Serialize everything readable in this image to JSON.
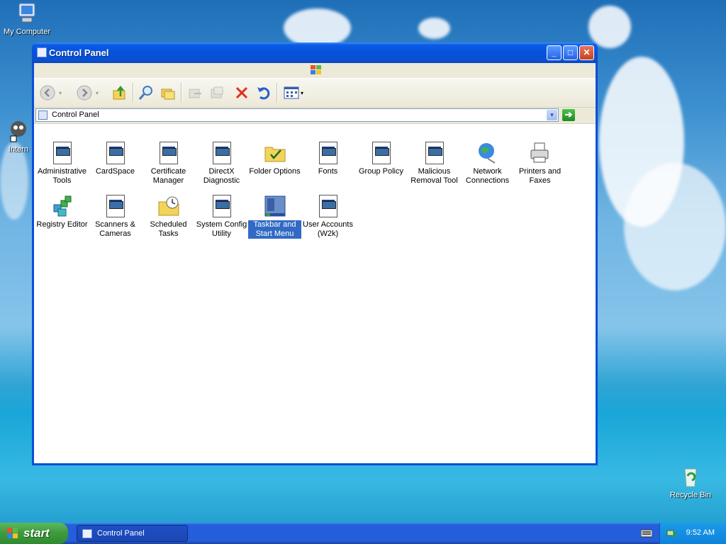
{
  "desktop": {
    "icons": [
      {
        "label": "My Computer",
        "icon": "my-computer-icon"
      },
      {
        "label": "Intern",
        "icon": "internet-icon"
      },
      {
        "label": "Recycle Bin",
        "icon": "recycle-bin-icon"
      }
    ]
  },
  "window": {
    "title": "Control Panel",
    "address": "Control Panel",
    "buttons": {
      "minimize": "_",
      "maximize": "□",
      "close": "✕",
      "go": "➔",
      "dropdown": "▾"
    },
    "items": [
      {
        "label": "Administrative Tools",
        "icon": "administrative-tools-icon"
      },
      {
        "label": "CardSpace",
        "icon": "cardspace-icon"
      },
      {
        "label": "Certificate Manager",
        "icon": "certificate-manager-icon"
      },
      {
        "label": "DirectX Diagnostic",
        "icon": "directx-diagnostic-icon"
      },
      {
        "label": "Folder Options",
        "icon": "folder-options-icon"
      },
      {
        "label": "Fonts",
        "icon": "fonts-icon"
      },
      {
        "label": "Group Policy",
        "icon": "group-policy-icon"
      },
      {
        "label": "Malicious Removal Tool",
        "icon": "malicious-removal-tool-icon"
      },
      {
        "label": "Network Connections",
        "icon": "network-connections-icon"
      },
      {
        "label": "Printers and Faxes",
        "icon": "printers-faxes-icon"
      },
      {
        "label": "Registry Editor",
        "icon": "registry-editor-icon"
      },
      {
        "label": "Scanners & Cameras",
        "icon": "scanners-cameras-icon"
      },
      {
        "label": "Scheduled Tasks",
        "icon": "scheduled-tasks-icon"
      },
      {
        "label": "System Config Utility",
        "icon": "system-config-utility-icon"
      },
      {
        "label": "Taskbar and Start Menu",
        "icon": "taskbar-start-menu-icon",
        "selected": true
      },
      {
        "label": "User Accounts (W2k)",
        "icon": "user-accounts-icon"
      }
    ]
  },
  "taskbar": {
    "start_label": "start",
    "task_label": "Control Panel",
    "clock": "9:52 AM"
  },
  "colors": {
    "title_blue": "#0653d9",
    "selection": "#316ac5",
    "start_green": "#3c9a3c"
  }
}
